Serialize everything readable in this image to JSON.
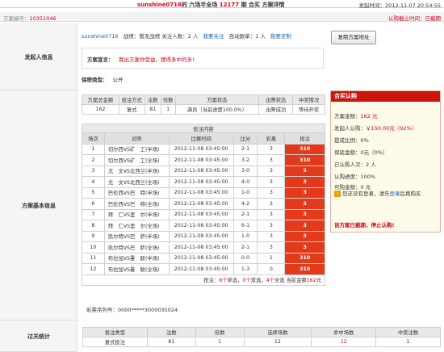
{
  "header": {
    "title_user": "sunshine0716",
    "title_mid": "的 六场半全场",
    "title_issue": "12177",
    "title_end": "期 合买 方案详情",
    "time_label": "发起时间：",
    "time_value": "2012-11-07 20:54:55"
  },
  "codebar": {
    "code_label": "方案编号：",
    "code_value": "10351046",
    "status_text": "认购截止时间：已截期"
  },
  "sections": {
    "sponsor": "发起人信息",
    "basic": "方案基本信息",
    "stats": "过关统计"
  },
  "sponsor": {
    "name": "sunshine0716",
    "record_label": "战绩：",
    "record_value": "暂无战绩",
    "follow_label": "关注人数：",
    "follow_value": "2 人",
    "follow_link": "我要关注",
    "auto_label": "自动跟单：",
    "auto_value": "1 人",
    "auto_link": "我要定制",
    "copy_button": "复制方案地址",
    "manifesto_label": "方案宣言：",
    "manifesto_text": "我出方案你受益，猜得多中的多！",
    "privacy_label": "保密类型：",
    "privacy_value": "公开"
  },
  "summary": {
    "headers": [
      "方案总金额",
      "投注方式",
      "注数",
      "倍数",
      "方案状态",
      "出票状态",
      "中奖情况"
    ],
    "row": [
      "162",
      "复式",
      "81",
      "1",
      "满员（当前进度100.0%）",
      "出票成功",
      "等待开奖"
    ]
  },
  "bets": {
    "caption": "投注内容",
    "headers": [
      "场次",
      "对阵",
      "比赛时间",
      "比分",
      "彩果",
      "投注"
    ],
    "rows": [
      [
        "1",
        "切尔西VS矿　工(半场)",
        "2012-11-08 03:45:00",
        "2-1",
        "3",
        "310"
      ],
      [
        "2",
        "切尔西VS矿　工(全场)",
        "2012-11-08 03:45:00",
        "3-2",
        "3",
        "310"
      ],
      [
        "3",
        "尤　文VS北西兰(半场)",
        "2012-11-08 03:45:00",
        "3-0",
        "3",
        "3"
      ],
      [
        "4",
        "尤　文VS北西兰(全场)",
        "2012-11-08 03:45:00",
        "4-0",
        "3",
        "3"
      ],
      [
        "5",
        "巴伦西VS巴　特(半场)",
        "2012-11-08 03:45:00",
        "1-0",
        "3",
        "3"
      ],
      [
        "6",
        "巴伦西VS巴　特(全场)",
        "2012-11-08 03:45:00",
        "4-2",
        "3",
        "3"
      ],
      [
        "7",
        "拜　仁VS里　尔(半场)",
        "2012-11-08 03:45:00",
        "2-1",
        "3",
        "3"
      ],
      [
        "8",
        "拜　仁VS里　尔(全场)",
        "2012-11-08 03:45:00",
        "6-1",
        "3",
        "3"
      ],
      [
        "9",
        "凯尔特VS巴　萨(半场)",
        "2012-11-08 03:45:00",
        "1-0",
        "3",
        "3"
      ],
      [
        "10",
        "凯尔特VS巴　萨(全场)",
        "2012-11-08 03:45:00",
        "2-1",
        "3",
        "3"
      ],
      [
        "11",
        "布拉加VS曼　联(半场)",
        "2012-11-08 03:45:00",
        "0-0",
        "1",
        "310"
      ],
      [
        "12",
        "布拉加VS曼　联(全场)",
        "2012-11-08 03:45:00",
        "1-3",
        "0",
        "310"
      ]
    ],
    "total_a": "投注：",
    "total_b": "8个",
    "total_c": "单选，",
    "total_d": "0个",
    "total_e": "双选，",
    "total_f": "4个",
    "total_g": "全选 当前金额",
    "total_h": "162",
    "total_i": "元"
  },
  "serial": "彩票序列号：0000*****3000035024",
  "join": {
    "title": "合买认购",
    "lines": [
      {
        "k": "方案金额：",
        "v": "162 元",
        "red": true
      },
      {
        "k": "发起人认购：",
        "v": "￥150.00元（92%）",
        "red": true
      },
      {
        "k": "提成比例：",
        "v": "0%",
        "red": false
      },
      {
        "k": "保底金额：",
        "v": "0元（0%）",
        "red": false
      },
      {
        "k": "已认购人次：",
        "v": "2 人",
        "red": false
      },
      {
        "k": "认购进度：",
        "v": "100%",
        "red": false
      },
      {
        "k": "可购金额：",
        "v": "0 元",
        "red": false
      }
    ],
    "login_a": "您还没有登录，请先",
    "login_link": "登录",
    "login_b": "后再购买",
    "closed": "该方案已截期，停止认购!"
  },
  "stats": {
    "headers": [
      "投注类型",
      "注数",
      "倍数",
      "选择场数",
      "命中场数",
      "中奖注数"
    ],
    "row": [
      "复式投注",
      "81",
      "1",
      "12",
      "12",
      "1"
    ]
  },
  "colors": {
    "accent_red": "#d0021b",
    "pick_bg": "#e43a1c",
    "panel_head": "#c9170e"
  }
}
